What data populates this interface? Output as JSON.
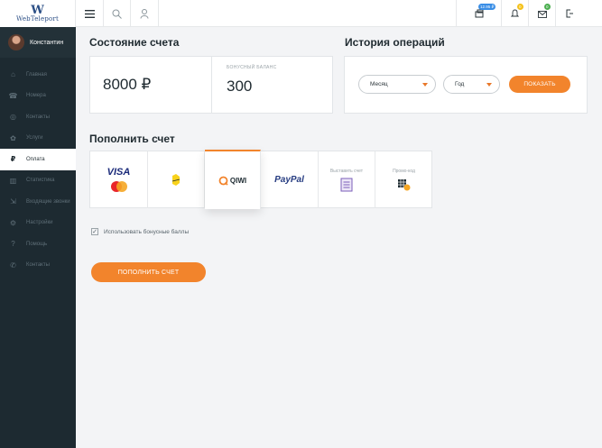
{
  "logo": {
    "mark": "W",
    "text": "WebTeleport"
  },
  "user": {
    "name": "Константин"
  },
  "sidebar": {
    "items": [
      {
        "label": "Главная",
        "icon": "home-icon",
        "glyph": "⌂"
      },
      {
        "label": "Номера",
        "icon": "phone-numbers-icon",
        "glyph": "☎"
      },
      {
        "label": "Контакты",
        "icon": "location-icon",
        "glyph": "◎"
      },
      {
        "label": "Услуги",
        "icon": "gift-icon",
        "glyph": "✿"
      },
      {
        "label": "Оплата",
        "icon": "ruble-icon",
        "glyph": "₽"
      },
      {
        "label": "Статистика",
        "icon": "stats-icon",
        "glyph": "▥"
      },
      {
        "label": "Входящие звонки",
        "icon": "incoming-call-icon",
        "glyph": "⇲"
      },
      {
        "label": "Настройки",
        "icon": "settings-icon",
        "glyph": "⚙"
      },
      {
        "label": "Помощь",
        "icon": "help-icon",
        "glyph": "?"
      },
      {
        "label": "Контакты",
        "icon": "contacts-phone-icon",
        "glyph": "✆"
      }
    ],
    "active_index": 4
  },
  "topbar": {
    "menu_icon": "hamburger-icon",
    "search_icon": "search-icon",
    "user_icon": "user-icon",
    "balance_badge": "12.95 ₽",
    "bell_badge": "0",
    "mail_badge": "0"
  },
  "account": {
    "title": "Состояние счета",
    "balance": "8000 ₽",
    "bonus_label": "БОНУСНЫЙ БАЛАНС",
    "bonus_value": "300"
  },
  "history": {
    "title": "История операций",
    "month_select": "Месяц",
    "year_select": "Год",
    "show_button": "ПОКАЗАТЬ"
  },
  "topup": {
    "title": "Пополнить счет",
    "methods": [
      {
        "name": "VISA",
        "sub": "MasterCard"
      },
      {
        "name": "Beeline"
      },
      {
        "name": "QIWI",
        "selected": true
      },
      {
        "name": "PayPal"
      },
      {
        "name": "Выставить счет"
      },
      {
        "name": "Промо-код"
      }
    ],
    "bonus_checkbox": "Использовать бонусные баллы",
    "bonus_checked": true,
    "submit_button": "ПОПОЛНИТЬ СЧЕТ"
  },
  "colors": {
    "accent": "#f2842c",
    "sidebar_bg": "#1d2a31",
    "badge_blue": "#3a8ee6",
    "badge_yellow": "#f5c21b",
    "badge_green": "#4caf50"
  }
}
